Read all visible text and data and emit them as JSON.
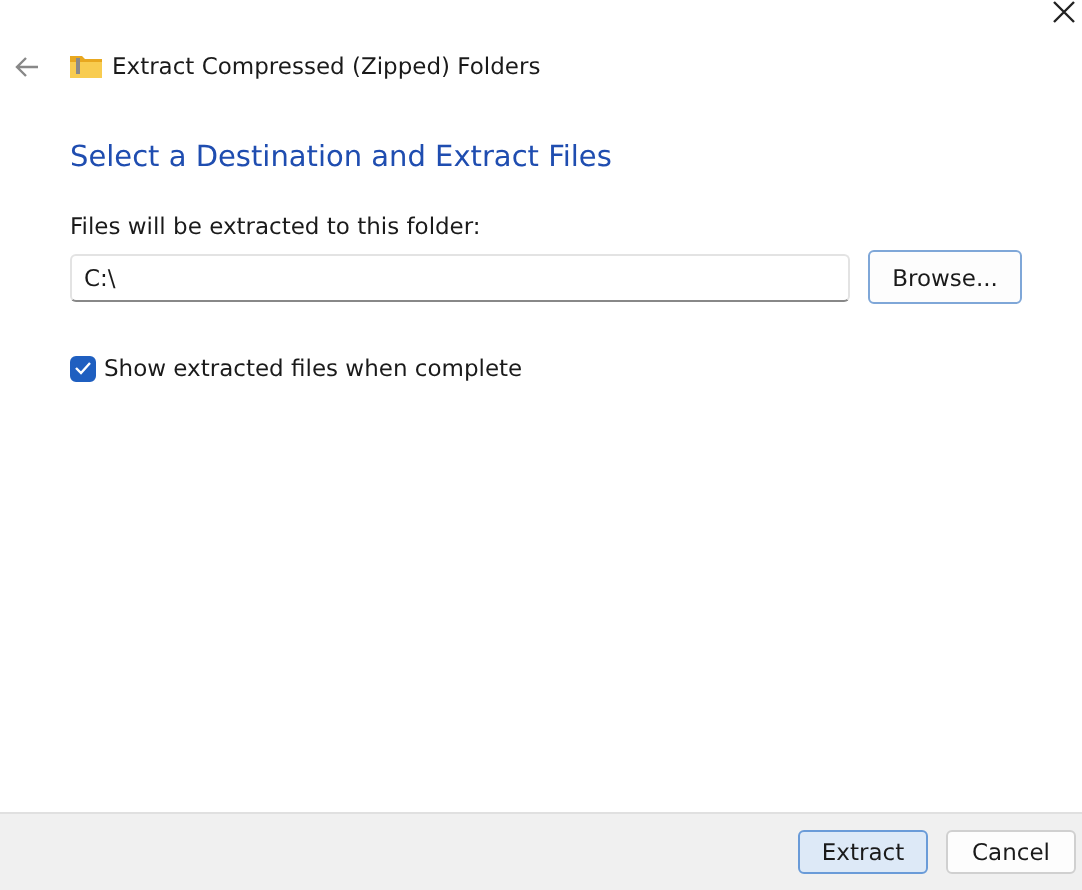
{
  "window": {
    "title": "Extract Compressed (Zipped) Folders"
  },
  "heading": "Select a Destination and Extract Files",
  "destination": {
    "label": "Files will be extracted to this folder:",
    "value": "C:\\",
    "browse_button": "Browse..."
  },
  "show_files": {
    "label": "Show extracted files when complete",
    "checked": true
  },
  "buttons": [
    {
      "label": "Extract",
      "default": true
    },
    {
      "label": "Cancel",
      "default": false
    }
  ]
}
